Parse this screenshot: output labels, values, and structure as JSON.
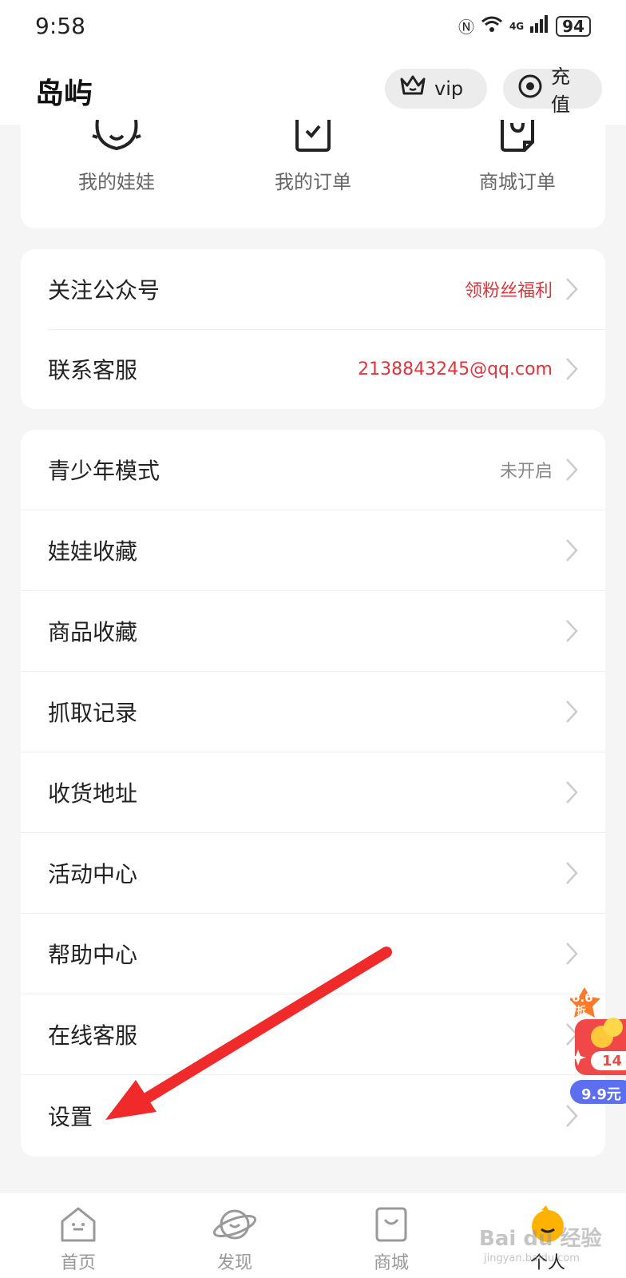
{
  "status_bar": {
    "time": "9:58",
    "network": "4G",
    "battery": "94"
  },
  "header": {
    "title": "岛屿",
    "vip_label": "vip",
    "recharge_label": "充值"
  },
  "quick_links": [
    {
      "label": "我的娃娃",
      "icon": "doll-icon"
    },
    {
      "label": "我的订单",
      "icon": "order-icon"
    },
    {
      "label": "商城订单",
      "icon": "mall-order-icon"
    }
  ],
  "contact": [
    {
      "label": "关注公众号",
      "value": "领粉丝福利"
    },
    {
      "label": "联系客服",
      "value": "2138843245@qq.com"
    }
  ],
  "menu": [
    {
      "label": "青少年模式",
      "value": "未开启"
    },
    {
      "label": "娃娃收藏",
      "value": ""
    },
    {
      "label": "商品收藏",
      "value": ""
    },
    {
      "label": "抓取记录",
      "value": ""
    },
    {
      "label": "收货地址",
      "value": ""
    },
    {
      "label": "活动中心",
      "value": ""
    },
    {
      "label": "帮助中心",
      "value": ""
    },
    {
      "label": "在线客服",
      "value": ""
    },
    {
      "label": "设置",
      "value": ""
    }
  ],
  "promo": {
    "discount": "6.6",
    "discount_unit": "折",
    "count": "14",
    "price": "9.9元"
  },
  "tabs": [
    {
      "label": "首页",
      "icon": "home-icon"
    },
    {
      "label": "发现",
      "icon": "planet-icon"
    },
    {
      "label": "商城",
      "icon": "shop-icon"
    },
    {
      "label": "个人",
      "icon": "profile-icon"
    }
  ],
  "watermark": {
    "text": "Bai du 经验",
    "sub": "jingyan.baidu.com"
  },
  "colors": {
    "accent_red": "#d9363e",
    "arrow_red": "#f02a2a",
    "background": "#f5f5f5"
  }
}
